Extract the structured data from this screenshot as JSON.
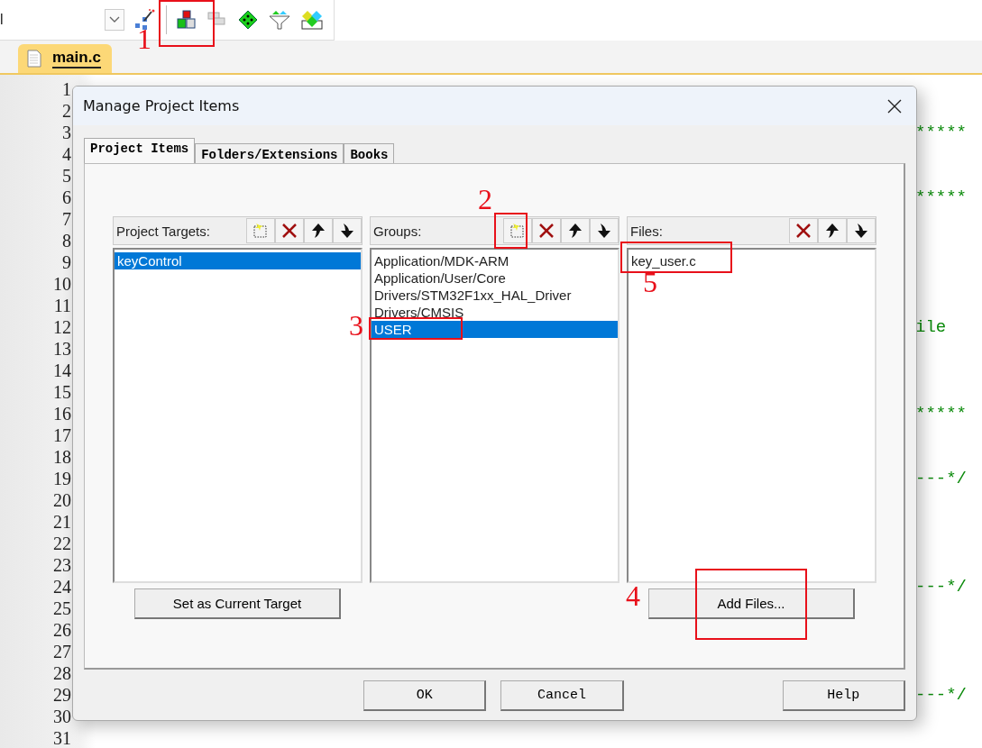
{
  "toolbar": {
    "combo_value": "l"
  },
  "file_tabs": [
    {
      "label": "main.c",
      "selected": true
    }
  ],
  "editor": {
    "lines": [
      {
        "number": "1"
      },
      {
        "number": "2"
      },
      {
        "number": "3",
        "tail": "*****"
      },
      {
        "number": "4"
      },
      {
        "number": "5"
      },
      {
        "number": "6",
        "tail": "*****"
      },
      {
        "number": "7"
      },
      {
        "number": "8"
      },
      {
        "number": "9"
      },
      {
        "number": "10"
      },
      {
        "number": "11"
      },
      {
        "number": "12",
        "tail": "ile"
      },
      {
        "number": "13"
      },
      {
        "number": "14"
      },
      {
        "number": "15"
      },
      {
        "number": "16",
        "tail": "*****"
      },
      {
        "number": "17"
      },
      {
        "number": "18"
      },
      {
        "number": "19",
        "tail": "---*/"
      },
      {
        "number": "20"
      },
      {
        "number": "21"
      },
      {
        "number": "22"
      },
      {
        "number": "23"
      },
      {
        "number": "24",
        "tail": "---*/"
      },
      {
        "number": "25"
      },
      {
        "number": "26"
      },
      {
        "number": "27"
      },
      {
        "number": "28"
      },
      {
        "number": "29",
        "tail": "---*/"
      },
      {
        "number": "30"
      },
      {
        "number": "31"
      }
    ]
  },
  "dialog": {
    "title": "Manage Project Items",
    "tabs": [
      {
        "label": "Project Items",
        "selected": true
      },
      {
        "label": "Folders/Extensions",
        "selected": false
      },
      {
        "label": "Books",
        "selected": false
      }
    ],
    "panels": [
      {
        "label": "Project Targets:",
        "tools": [
          {
            "kind": "new"
          },
          {
            "kind": "delete"
          },
          {
            "kind": "up"
          },
          {
            "kind": "down"
          }
        ],
        "items": [
          {
            "label": "keyControl",
            "selected": true
          }
        ],
        "button": "Set as Current Target"
      },
      {
        "label": "Groups:",
        "tools": [
          {
            "kind": "new"
          },
          {
            "kind": "delete"
          },
          {
            "kind": "up"
          },
          {
            "kind": "down"
          }
        ],
        "items": [
          {
            "label": "Application/MDK-ARM",
            "selected": false
          },
          {
            "label": "Application/User/Core",
            "selected": false
          },
          {
            "label": "Drivers/STM32F1xx_HAL_Driver",
            "selected": false
          },
          {
            "label": "Drivers/CMSIS",
            "selected": false
          },
          {
            "label": "USER",
            "selected": true
          }
        ]
      },
      {
        "label": "Files:",
        "tools": [
          {
            "kind": "delete"
          },
          {
            "kind": "up"
          },
          {
            "kind": "down"
          }
        ],
        "items": [
          {
            "label": "key_user.c",
            "selected": false
          }
        ],
        "button": "Add Files..."
      }
    ],
    "buttons": [
      "OK",
      "Cancel",
      "Help"
    ]
  },
  "annotations": [
    {
      "label": "1"
    },
    {
      "label": "2"
    },
    {
      "label": "3"
    },
    {
      "label": "4"
    },
    {
      "label": "5"
    }
  ]
}
